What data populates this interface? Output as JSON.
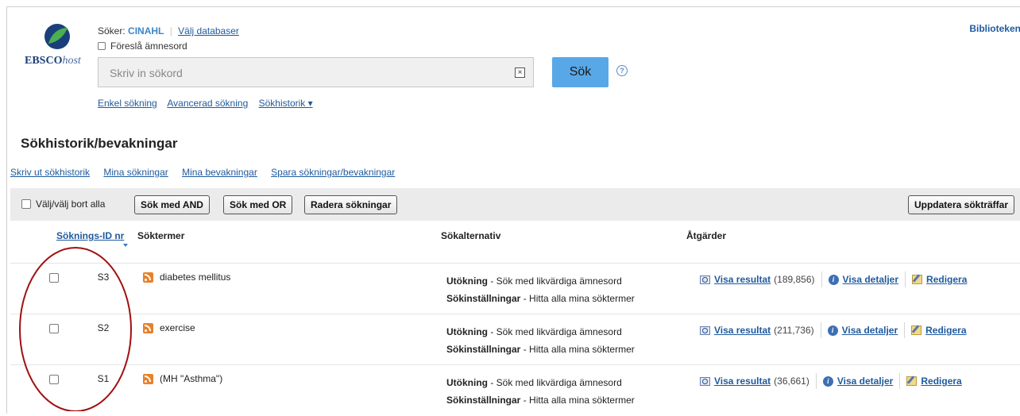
{
  "header": {
    "logo_text_bold": "EBSCO",
    "logo_text_italic": "host",
    "searching_label": "Söker:",
    "database_name": "CINAHL",
    "choose_databases": "Välj databaser",
    "suggest_subject_terms": "Föreslå ämnesord",
    "search_placeholder": "Skriv in sökord",
    "clear_symbol": "×",
    "search_button": "Sök",
    "help_symbol": "?",
    "library_link": "Biblioteken",
    "links": {
      "basic": "Enkel sökning",
      "advanced": "Avancerad sökning",
      "history": "Sökhistorik ▾"
    }
  },
  "section": {
    "title": "Sökhistorik/bevakningar",
    "links": {
      "print": "Skriv ut sökhistorik",
      "my_searches": "Mina sökningar",
      "my_alerts": "Mina bevakningar",
      "save": "Spara sökningar/bevakningar"
    }
  },
  "toolbar": {
    "select_all": "Välj/välj bort alla",
    "search_and": "Sök med AND",
    "search_or": "Sök med OR",
    "delete": "Radera sökningar",
    "update": "Uppdatera sökträffar"
  },
  "table": {
    "headers": {
      "id": "Söknings-ID nr",
      "terms": "Söktermer",
      "options": "Sökalternativ",
      "actions": "Åtgärder"
    },
    "expander_label": "Utökning",
    "expander_value": " - Sök med likvärdiga ämnesord",
    "mode_label": "Sökinställningar",
    "mode_value": " - Hitta alla mina söktermer",
    "view_results": "Visa resultat",
    "view_details": "Visa detaljer",
    "edit": "Redigera",
    "rows": [
      {
        "id": "S3",
        "term": "diabetes mellitus",
        "count": "(189,856)"
      },
      {
        "id": "S2",
        "term": "exercise",
        "count": "(211,736)"
      },
      {
        "id": "S1",
        "term": "(MH \"Asthma\")",
        "count": "(36,661)"
      }
    ]
  },
  "colors": {
    "link": "#1f5a9e",
    "accent_button": "#58a8e8",
    "annotation": "#a01010",
    "rss": "#e8812a"
  }
}
